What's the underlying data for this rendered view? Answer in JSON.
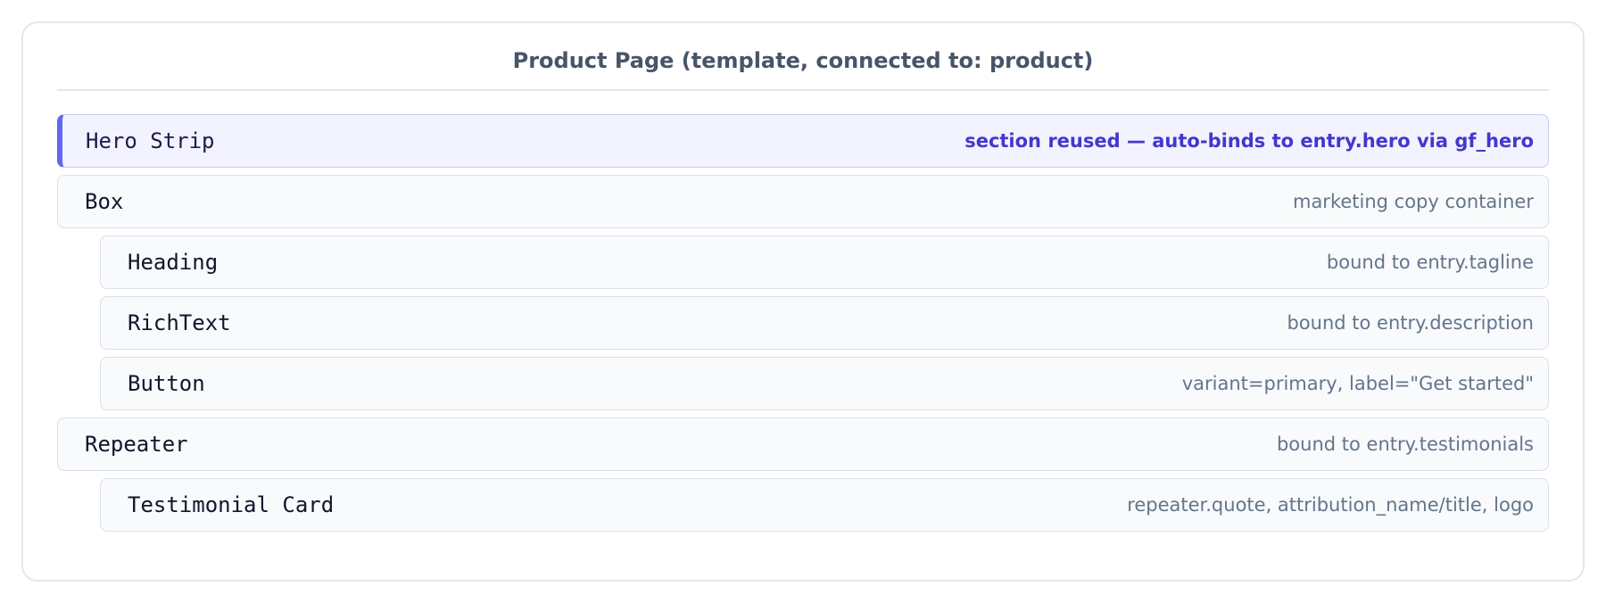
{
  "title": "Product Page (template, connected to: product)",
  "tree": [
    {
      "name": "Hero Strip",
      "note": "section reused — auto-binds to entry.hero via gf_hero"
    },
    {
      "name": "Box",
      "note": "marketing copy container"
    },
    {
      "name": "Heading",
      "note": "bound to entry.tagline"
    },
    {
      "name": "RichText",
      "note": "bound to entry.description"
    },
    {
      "name": "Button",
      "note": "variant=primary, label=\"Get started\""
    },
    {
      "name": "Repeater",
      "note": "bound to entry.testimonials"
    },
    {
      "name": "Testimonial Card",
      "note": "repeater.quote, attribution_name/title, logo"
    }
  ],
  "colors": {
    "accent": "#6366f1",
    "accent_text": "#4338ca",
    "highlight_bg": "#f3f2ff",
    "row_bg": "#f8fafc",
    "border": "#e2e8f0"
  }
}
